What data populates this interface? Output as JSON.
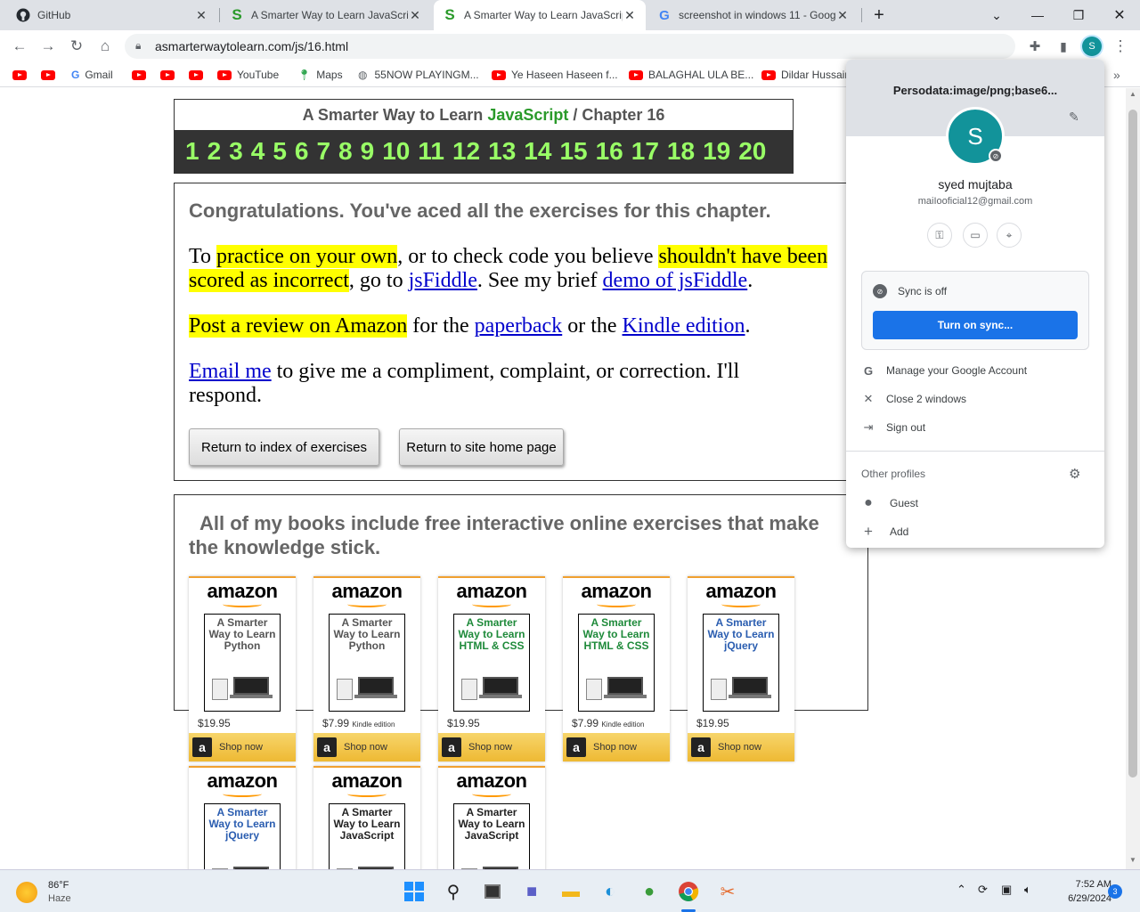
{
  "browser": {
    "tabs": [
      {
        "title": "GitHub",
        "icon": "github-icon"
      },
      {
        "title": "A Smarter Way to Learn JavaScript",
        "icon": "smarter-way-icon"
      },
      {
        "title": "A Smarter Way to Learn JavaScript",
        "icon": "smarter-way-icon"
      },
      {
        "title": "screenshot in windows 11 - Goog",
        "icon": "google-icon"
      }
    ],
    "new_tab": "+",
    "url": "asmarterwaytolearn.com/js/16.html",
    "bookmarks": [
      {
        "label": ""
      },
      {
        "label": ""
      },
      {
        "label": "Gmail"
      },
      {
        "label": ""
      },
      {
        "label": ""
      },
      {
        "label": ""
      },
      {
        "label": "YouTube"
      },
      {
        "label": "Maps"
      },
      {
        "label": "55NOW PLAYINGM..."
      },
      {
        "label": "Ye Haseen Haseen f..."
      },
      {
        "label": "BALAGHAL ULA BE..."
      },
      {
        "label": "Dildar Hussain"
      }
    ],
    "avatar_letter": "S"
  },
  "page": {
    "header": {
      "title_prefix": "A Smarter Way to Learn",
      "title_js": "JavaScript",
      "title_suffix": "/  Chapter 16",
      "chapters": [
        "1",
        "2",
        "3",
        "4",
        "5",
        "6",
        "7",
        "8",
        "9",
        "10",
        "11",
        "12",
        "13",
        "14",
        "15",
        "16",
        "17",
        "18",
        "19",
        "20"
      ]
    },
    "congrats": "Congratulations. You've aced all the exercises for this chapter.",
    "p1": {
      "t1": "To ",
      "h1": "practice on your own",
      "t2": ", or to check code you believe ",
      "h2": "shouldn't have been scored as incorrect",
      "t3": ", go to ",
      "l1": "jsFiddle",
      "t4": ". See my brief ",
      "l2": "demo of jsFiddle",
      "t5": "."
    },
    "p2": {
      "h1": "Post a review on Amazon",
      "t1": " for the ",
      "l1": "paperback",
      "t2": " or the ",
      "l2": "Kindle edition",
      "t3": "."
    },
    "p3": {
      "l1": "Email me",
      "t1": " to give me a compliment, complaint, or correction. I'll respond."
    },
    "buttons": {
      "index": "Return to index of exercises",
      "home": "Return to site home page"
    },
    "books_title": "All of my books include free interactive online exercises that make the knowledge stick.",
    "books": [
      {
        "brand": "amazon",
        "title": "A Smarter Way to Learn Python",
        "color": "#555555",
        "price": "$19.95",
        "edition": "",
        "shop": "Shop now"
      },
      {
        "brand": "amazon",
        "title": "A Smarter Way to Learn Python",
        "color": "#555555",
        "price": "$7.99",
        "edition": "Kindle edition",
        "shop": "Shop now"
      },
      {
        "brand": "amazon",
        "title": "A Smarter Way to Learn HTML & CSS",
        "color": "#1e8a3a",
        "price": "$19.95",
        "edition": "",
        "shop": "Shop now"
      },
      {
        "brand": "amazon",
        "title": "A Smarter Way to Learn HTML & CSS",
        "color": "#1e8a3a",
        "price": "$7.99",
        "edition": "Kindle edition",
        "shop": "Shop now"
      },
      {
        "brand": "amazon",
        "title": "A Smarter Way to Learn jQuery",
        "color": "#2a5db0",
        "price": "$19.95",
        "edition": "",
        "shop": "Shop now"
      },
      {
        "brand": "amazon",
        "title": "A Smarter Way to Learn jQuery",
        "color": "#2a5db0",
        "price": "",
        "edition": "",
        "shop": ""
      },
      {
        "brand": "amazon",
        "title": "A Smarter Way to Learn JavaScript",
        "color": "#222222",
        "price": "",
        "edition": "",
        "shop": ""
      },
      {
        "brand": "amazon",
        "title": "A Smarter Way to Learn JavaScript",
        "color": "#222222",
        "price": "",
        "edition": "",
        "shop": ""
      }
    ]
  },
  "profile_menu": {
    "header_name": "Persodata:image/png;base6...",
    "avatar_letter": "S",
    "name": "syed mujtaba",
    "email": "maiIooficial12@gmail.com",
    "sync_status": "Sync is off",
    "sync_button": "Turn on sync...",
    "items": [
      {
        "label": "Manage your Google Account",
        "icon": "google-g-icon"
      },
      {
        "label": "Close 2 windows",
        "icon": "close-icon"
      },
      {
        "label": "Sign out",
        "icon": "sign-out-icon"
      }
    ],
    "other_profiles": "Other profiles",
    "profiles": [
      {
        "label": "Guest",
        "icon": "guest-icon"
      },
      {
        "label": "Add",
        "icon": "add-icon"
      }
    ]
  },
  "taskbar": {
    "temp": "86°F",
    "condition": "Haze",
    "time": "7:52 AM",
    "date": "6/29/2024",
    "notifications": "3"
  }
}
